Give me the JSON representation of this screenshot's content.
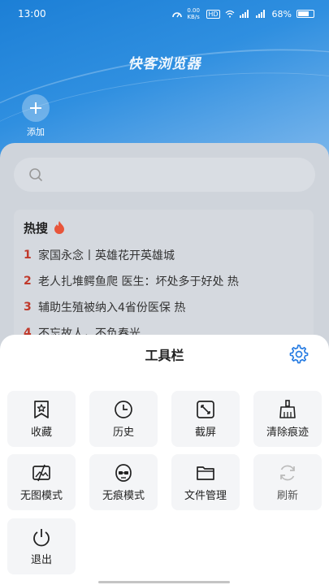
{
  "status_bar": {
    "time": "13:00",
    "battery": "68%",
    "net_speed": "0.00 KB/s"
  },
  "hero": {
    "brand": "快客浏览器",
    "add_label": "添加"
  },
  "search": {
    "placeholder": ""
  },
  "hot": {
    "title": "热搜",
    "items": [
      {
        "rank": "1",
        "text": "家国永念丨英雄花开英雄城"
      },
      {
        "rank": "2",
        "text": "老人扎堆鳄鱼爬 医生：坏处多于好处  热"
      },
      {
        "rank": "3",
        "text": "辅助生殖被纳入4省份医保  热"
      },
      {
        "rank": "4",
        "text": "不忘故人，不负春光"
      }
    ]
  },
  "toolbar": {
    "title": "工具栏",
    "tools": [
      {
        "label": "收藏",
        "icon": "bookmark-star-icon"
      },
      {
        "label": "历史",
        "icon": "clock-icon"
      },
      {
        "label": "截屏",
        "icon": "screenshot-icon"
      },
      {
        "label": "清除痕迹",
        "icon": "broom-icon"
      },
      {
        "label": "无图模式",
        "icon": "no-image-icon"
      },
      {
        "label": "无痕模式",
        "icon": "incognito-icon"
      },
      {
        "label": "文件管理",
        "icon": "folder-icon"
      },
      {
        "label": "刷新",
        "icon": "refresh-icon"
      },
      {
        "label": "退出",
        "icon": "power-icon"
      }
    ]
  }
}
